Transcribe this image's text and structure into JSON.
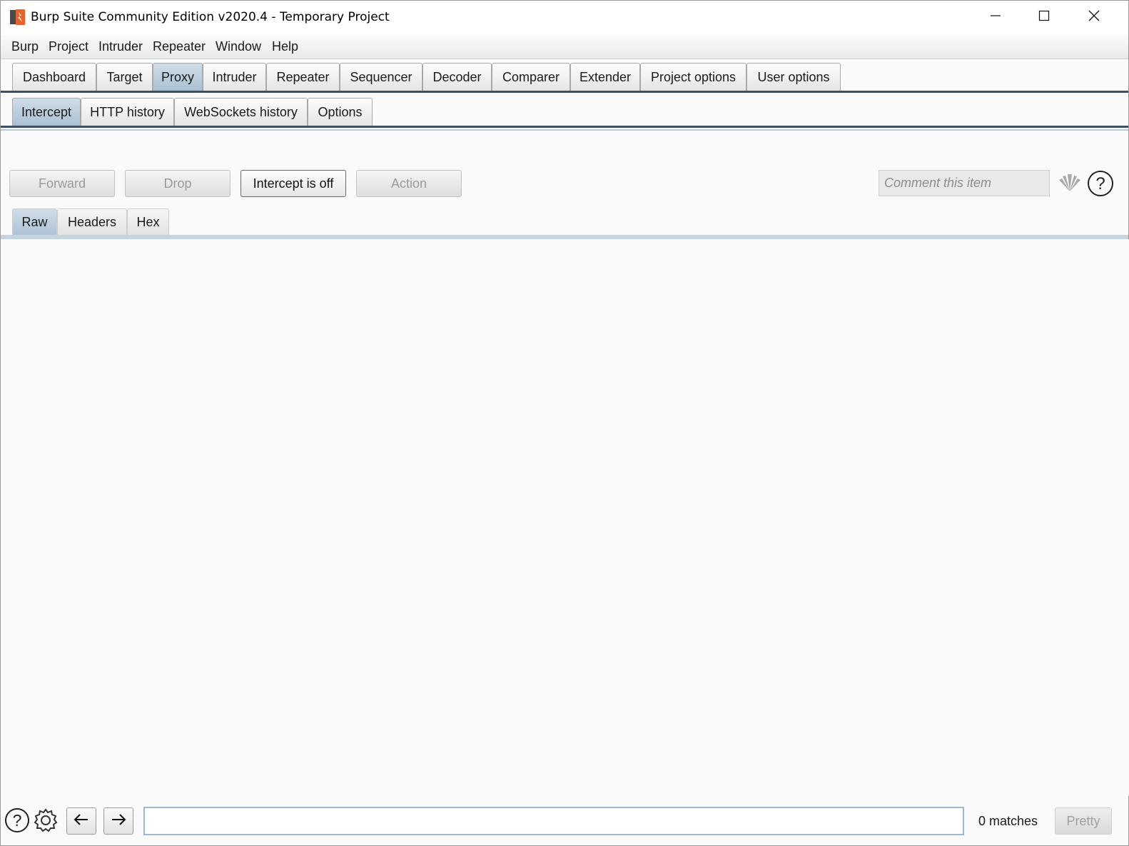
{
  "window": {
    "title": "Burp Suite Community Edition v2020.4 - Temporary Project",
    "icons": {
      "app": "burp-logo-icon",
      "minimize": "minimize-icon",
      "maximize": "maximize-icon",
      "close": "close-icon"
    }
  },
  "menu": {
    "items": [
      "Burp",
      "Project",
      "Intruder",
      "Repeater",
      "Window",
      "Help"
    ]
  },
  "main_tabs": {
    "items": [
      "Dashboard",
      "Target",
      "Proxy",
      "Intruder",
      "Repeater",
      "Sequencer",
      "Decoder",
      "Comparer",
      "Extender",
      "Project options",
      "User options"
    ],
    "active": "Proxy"
  },
  "proxy_tabs": {
    "items": [
      "Intercept",
      "HTTP history",
      "WebSockets history",
      "Options"
    ],
    "active": "Intercept"
  },
  "intercept": {
    "buttons": {
      "forward": "Forward",
      "drop": "Drop",
      "intercept_toggle": "Intercept is off",
      "action": "Action"
    },
    "comment_placeholder": "Comment this item",
    "icons": {
      "highlight": "highlight-icon",
      "help": "help-icon"
    }
  },
  "view_tabs": {
    "items": [
      "Raw",
      "Headers",
      "Hex"
    ],
    "active": "Raw"
  },
  "editor": {
    "content": ""
  },
  "bottom_bar": {
    "icons": {
      "help": "help-icon",
      "settings": "gear-icon",
      "back": "arrow-left-icon",
      "forward": "arrow-right-icon"
    },
    "search_value": "",
    "matches": "0 matches",
    "pretty_label": "Pretty"
  },
  "colors": {
    "active_tab": "#aec3d4",
    "tab_underline": "#3c4f63",
    "accent_logo": "#e8632b"
  }
}
